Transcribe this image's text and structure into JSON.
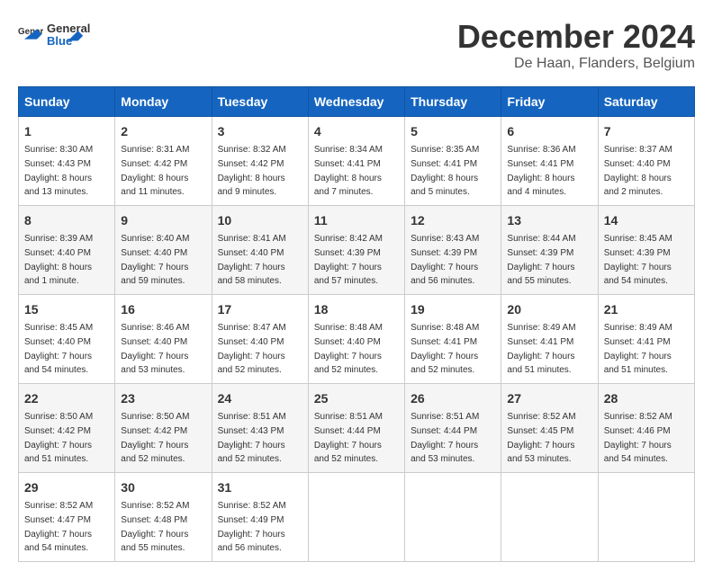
{
  "header": {
    "logo_general": "General",
    "logo_blue": "Blue",
    "month": "December 2024",
    "location": "De Haan, Flanders, Belgium"
  },
  "days_of_week": [
    "Sunday",
    "Monday",
    "Tuesday",
    "Wednesday",
    "Thursday",
    "Friday",
    "Saturday"
  ],
  "weeks": [
    [
      {
        "day": "1",
        "sunrise": "8:30 AM",
        "sunset": "4:43 PM",
        "daylight": "8 hours and 13 minutes."
      },
      {
        "day": "2",
        "sunrise": "8:31 AM",
        "sunset": "4:42 PM",
        "daylight": "8 hours and 11 minutes."
      },
      {
        "day": "3",
        "sunrise": "8:32 AM",
        "sunset": "4:42 PM",
        "daylight": "8 hours and 9 minutes."
      },
      {
        "day": "4",
        "sunrise": "8:34 AM",
        "sunset": "4:41 PM",
        "daylight": "8 hours and 7 minutes."
      },
      {
        "day": "5",
        "sunrise": "8:35 AM",
        "sunset": "4:41 PM",
        "daylight": "8 hours and 5 minutes."
      },
      {
        "day": "6",
        "sunrise": "8:36 AM",
        "sunset": "4:41 PM",
        "daylight": "8 hours and 4 minutes."
      },
      {
        "day": "7",
        "sunrise": "8:37 AM",
        "sunset": "4:40 PM",
        "daylight": "8 hours and 2 minutes."
      }
    ],
    [
      {
        "day": "8",
        "sunrise": "8:39 AM",
        "sunset": "4:40 PM",
        "daylight": "8 hours and 1 minute."
      },
      {
        "day": "9",
        "sunrise": "8:40 AM",
        "sunset": "4:40 PM",
        "daylight": "7 hours and 59 minutes."
      },
      {
        "day": "10",
        "sunrise": "8:41 AM",
        "sunset": "4:40 PM",
        "daylight": "7 hours and 58 minutes."
      },
      {
        "day": "11",
        "sunrise": "8:42 AM",
        "sunset": "4:39 PM",
        "daylight": "7 hours and 57 minutes."
      },
      {
        "day": "12",
        "sunrise": "8:43 AM",
        "sunset": "4:39 PM",
        "daylight": "7 hours and 56 minutes."
      },
      {
        "day": "13",
        "sunrise": "8:44 AM",
        "sunset": "4:39 PM",
        "daylight": "7 hours and 55 minutes."
      },
      {
        "day": "14",
        "sunrise": "8:45 AM",
        "sunset": "4:39 PM",
        "daylight": "7 hours and 54 minutes."
      }
    ],
    [
      {
        "day": "15",
        "sunrise": "8:45 AM",
        "sunset": "4:40 PM",
        "daylight": "7 hours and 54 minutes."
      },
      {
        "day": "16",
        "sunrise": "8:46 AM",
        "sunset": "4:40 PM",
        "daylight": "7 hours and 53 minutes."
      },
      {
        "day": "17",
        "sunrise": "8:47 AM",
        "sunset": "4:40 PM",
        "daylight": "7 hours and 52 minutes."
      },
      {
        "day": "18",
        "sunrise": "8:48 AM",
        "sunset": "4:40 PM",
        "daylight": "7 hours and 52 minutes."
      },
      {
        "day": "19",
        "sunrise": "8:48 AM",
        "sunset": "4:41 PM",
        "daylight": "7 hours and 52 minutes."
      },
      {
        "day": "20",
        "sunrise": "8:49 AM",
        "sunset": "4:41 PM",
        "daylight": "7 hours and 51 minutes."
      },
      {
        "day": "21",
        "sunrise": "8:49 AM",
        "sunset": "4:41 PM",
        "daylight": "7 hours and 51 minutes."
      }
    ],
    [
      {
        "day": "22",
        "sunrise": "8:50 AM",
        "sunset": "4:42 PM",
        "daylight": "7 hours and 51 minutes."
      },
      {
        "day": "23",
        "sunrise": "8:50 AM",
        "sunset": "4:42 PM",
        "daylight": "7 hours and 52 minutes."
      },
      {
        "day": "24",
        "sunrise": "8:51 AM",
        "sunset": "4:43 PM",
        "daylight": "7 hours and 52 minutes."
      },
      {
        "day": "25",
        "sunrise": "8:51 AM",
        "sunset": "4:44 PM",
        "daylight": "7 hours and 52 minutes."
      },
      {
        "day": "26",
        "sunrise": "8:51 AM",
        "sunset": "4:44 PM",
        "daylight": "7 hours and 53 minutes."
      },
      {
        "day": "27",
        "sunrise": "8:52 AM",
        "sunset": "4:45 PM",
        "daylight": "7 hours and 53 minutes."
      },
      {
        "day": "28",
        "sunrise": "8:52 AM",
        "sunset": "4:46 PM",
        "daylight": "7 hours and 54 minutes."
      }
    ],
    [
      {
        "day": "29",
        "sunrise": "8:52 AM",
        "sunset": "4:47 PM",
        "daylight": "7 hours and 54 minutes."
      },
      {
        "day": "30",
        "sunrise": "8:52 AM",
        "sunset": "4:48 PM",
        "daylight": "7 hours and 55 minutes."
      },
      {
        "day": "31",
        "sunrise": "8:52 AM",
        "sunset": "4:49 PM",
        "daylight": "7 hours and 56 minutes."
      },
      null,
      null,
      null,
      null
    ]
  ]
}
